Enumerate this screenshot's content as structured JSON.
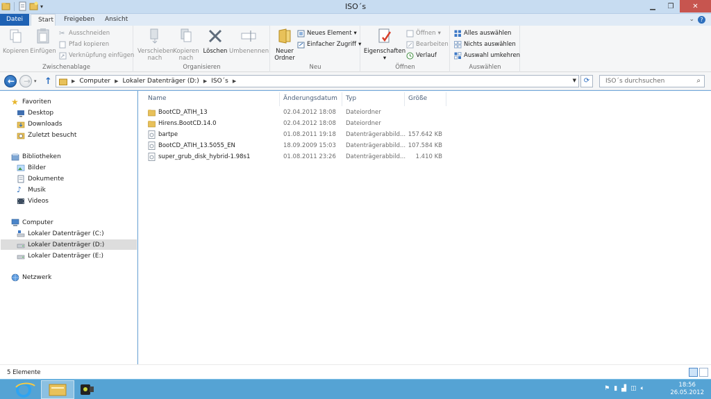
{
  "window": {
    "title": "ISO´s"
  },
  "ribbon_tabs": {
    "file": "Datei",
    "start": "Start",
    "share": "Freigeben",
    "view": "Ansicht"
  },
  "ribbon": {
    "clipboard": {
      "label": "Zwischenablage",
      "copy": "Kopieren",
      "paste": "Einfügen",
      "cut": "Ausschneiden",
      "copy_path": "Pfad kopieren",
      "paste_shortcut": "Verknüpfung einfügen"
    },
    "organize": {
      "label": "Organisieren",
      "move_l1": "Verschieben",
      "move_l2": "nach",
      "copyto_l1": "Kopieren",
      "copyto_l2": "nach",
      "delete": "Löschen",
      "rename": "Umbenennen"
    },
    "new": {
      "label": "Neu",
      "folder_l1": "Neuer",
      "folder_l2": "Ordner",
      "new_item": "Neues Element",
      "easy_access": "Einfacher Zugriff"
    },
    "open": {
      "label": "Öffnen",
      "properties": "Eigenschaften",
      "open": "Öffnen",
      "edit": "Bearbeiten",
      "history": "Verlauf"
    },
    "select": {
      "label": "Auswählen",
      "select_all": "Alles auswählen",
      "select_none": "Nichts auswählen",
      "invert": "Auswahl umkehren"
    }
  },
  "address": {
    "segments": [
      "Computer",
      "Lokaler Datenträger (D:)",
      "ISO´s"
    ],
    "search_placeholder": "ISO´s durchsuchen"
  },
  "nav": {
    "favorites": "Favoriten",
    "desktop": "Desktop",
    "downloads": "Downloads",
    "recent": "Zuletzt besucht",
    "libraries": "Bibliotheken",
    "pictures": "Bilder",
    "documents": "Dokumente",
    "music": "Musik",
    "videos": "Videos",
    "computer": "Computer",
    "drive_c": "Lokaler Datenträger (C:)",
    "drive_d": "Lokaler Datenträger (D:)",
    "drive_e": "Lokaler Datenträger (E:)",
    "network": "Netzwerk"
  },
  "columns": {
    "name": "Name",
    "date": "Änderungsdatum",
    "type": "Typ",
    "size": "Größe"
  },
  "files": [
    {
      "name": "BootCD_ATIH_13",
      "date": "02.04.2012 18:08",
      "type": "Dateiordner",
      "size": "",
      "icon": "folder-icon"
    },
    {
      "name": "Hirens.BootCD.14.0",
      "date": "02.04.2012 18:08",
      "type": "Dateiordner",
      "size": "",
      "icon": "folder-icon"
    },
    {
      "name": "bartpe",
      "date": "01.08.2011 19:18",
      "type": "Datenträgerabbild...",
      "size": "157.642 KB",
      "icon": "disc-image-icon"
    },
    {
      "name": "BootCD_ATIH_13.5055_EN",
      "date": "18.09.2009 15:03",
      "type": "Datenträgerabbild...",
      "size": "107.584 KB",
      "icon": "disc-image-icon"
    },
    {
      "name": "super_grub_disk_hybrid-1.98s1",
      "date": "01.08.2011 23:26",
      "type": "Datenträgerabbild...",
      "size": "1.410 KB",
      "icon": "disc-image-icon"
    }
  ],
  "status": {
    "count": "5 Elemente"
  },
  "taskbar": {
    "time": "18:56",
    "date": "26.05.2012"
  },
  "colors": {
    "file_tab": "#1f62b4",
    "taskbar": "#55a3d4",
    "close": "#c7554f",
    "folder": "#e8c15a"
  }
}
